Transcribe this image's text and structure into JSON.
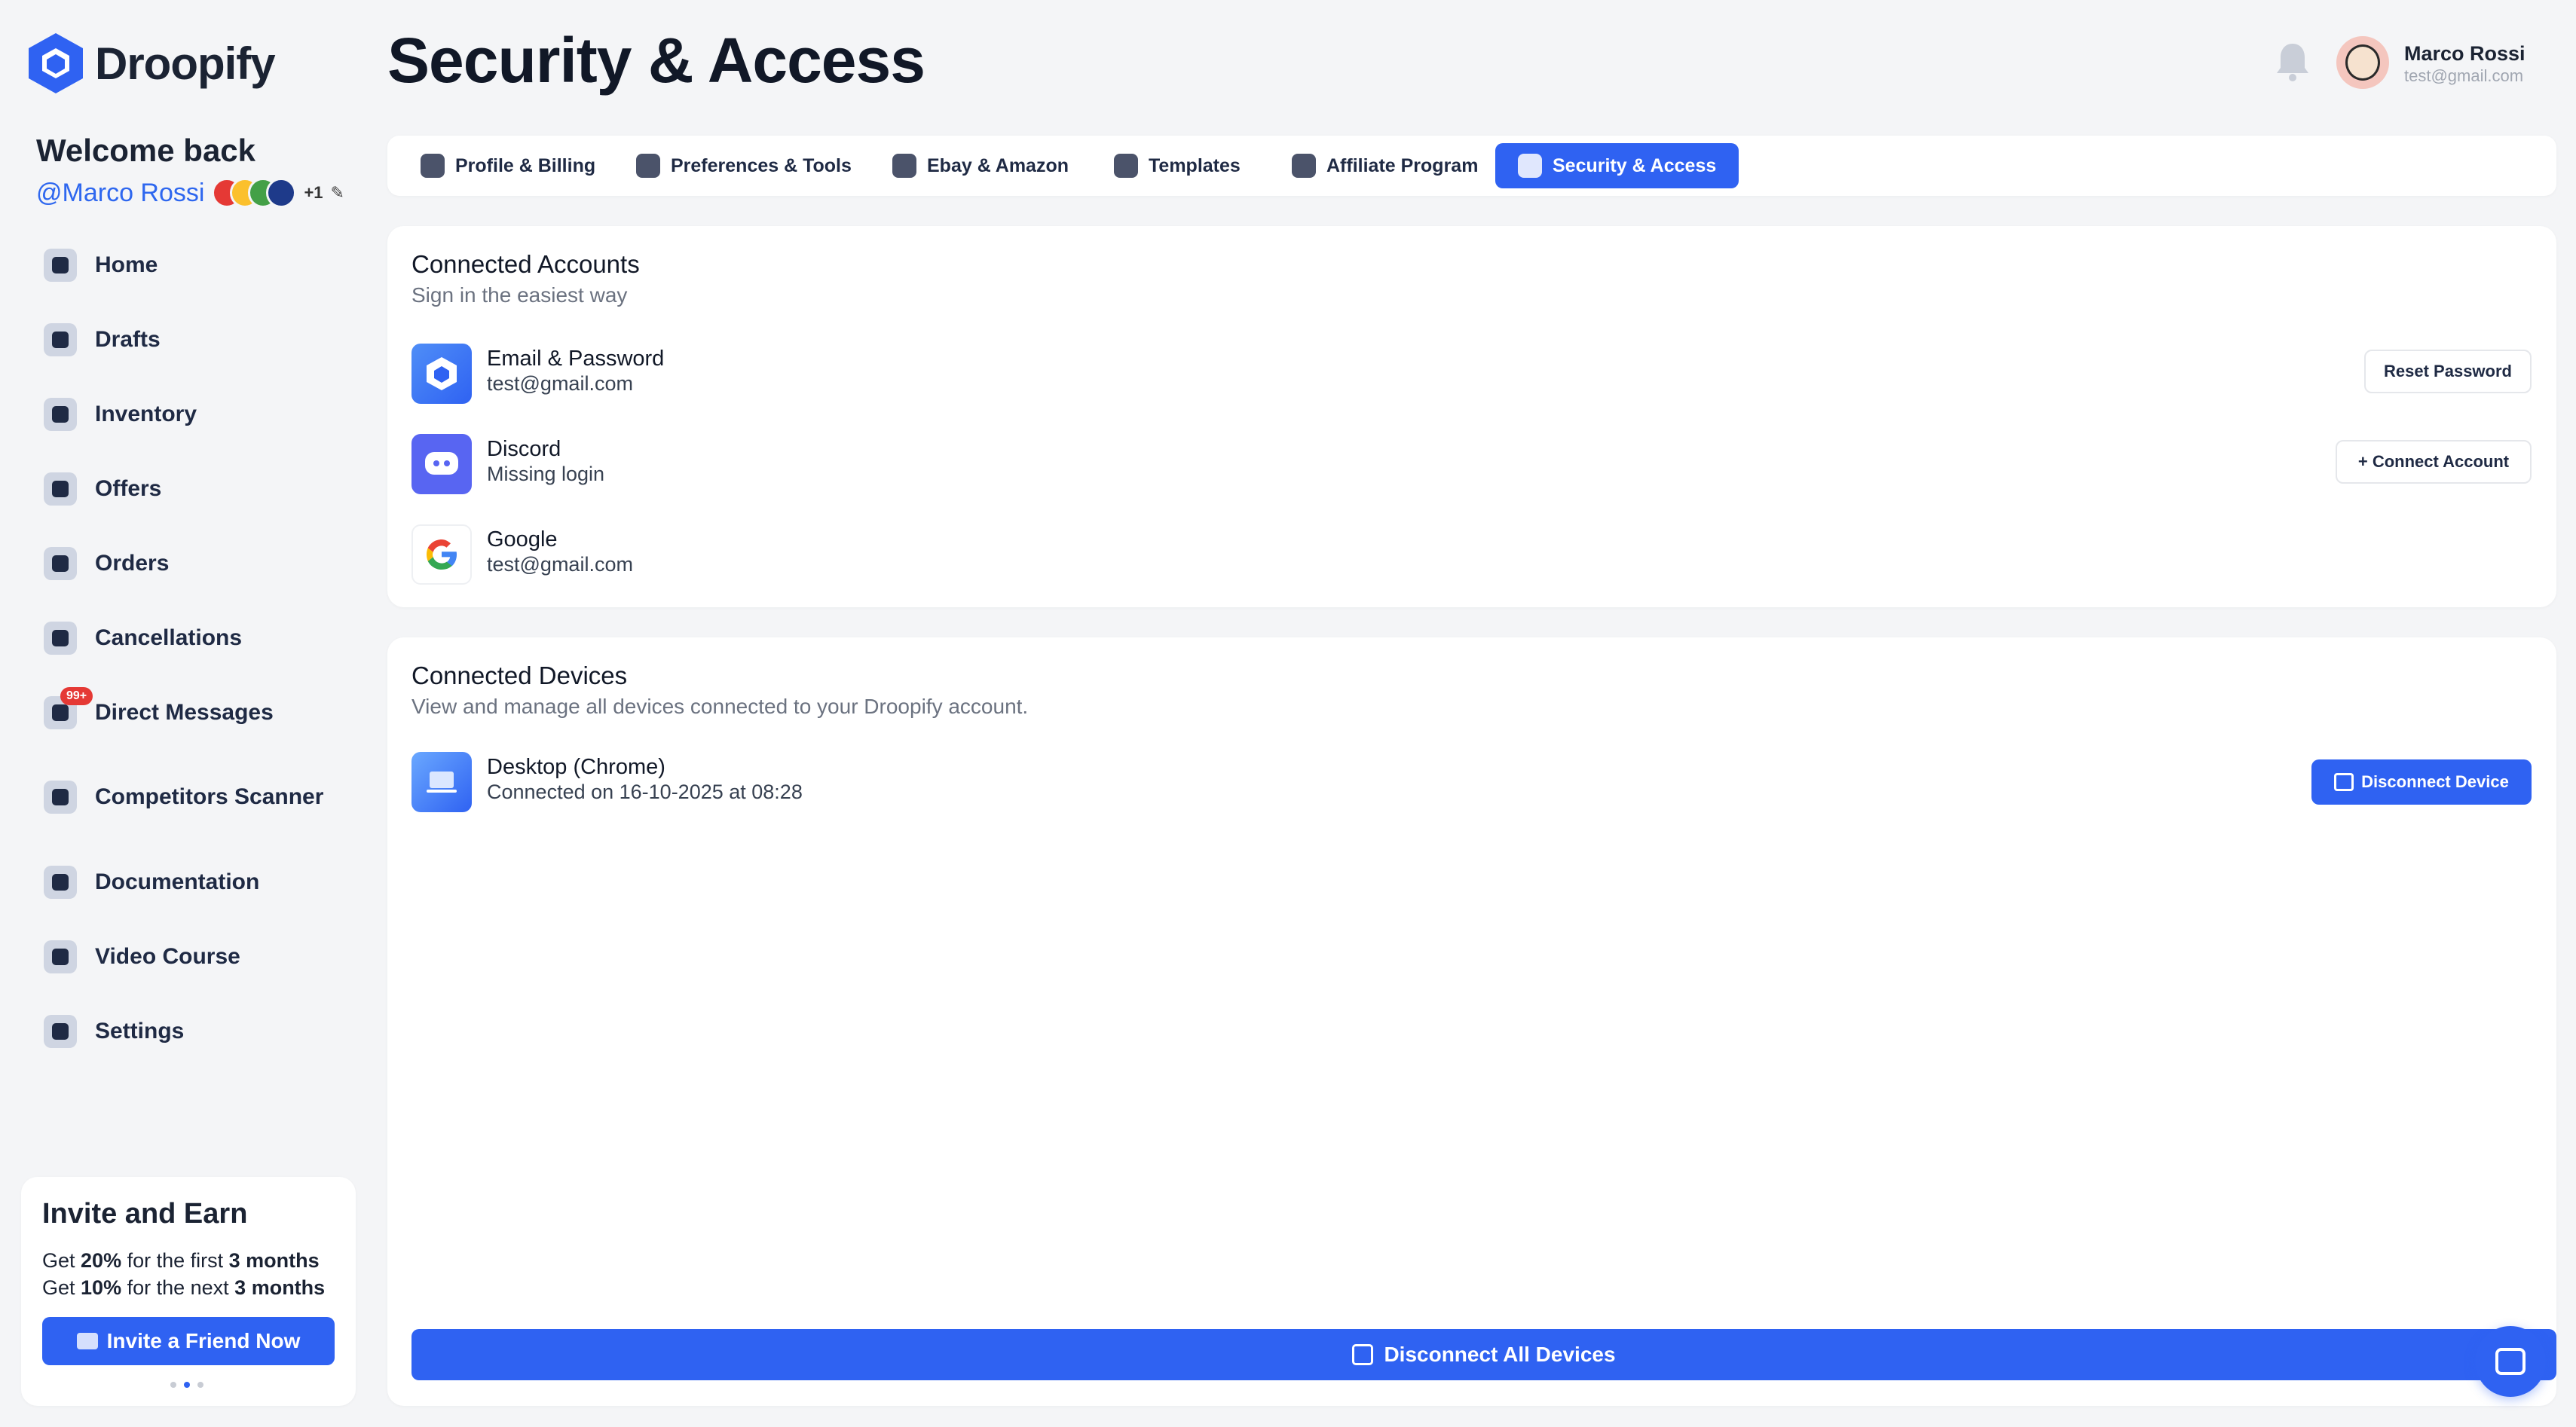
{
  "brand": {
    "name": "Droopify",
    "accent": "#2f62f2"
  },
  "sidebar": {
    "welcome": "Welcome back",
    "handle": "@Marco Rossi",
    "extra_count": "+1",
    "items": [
      {
        "label": "Home",
        "icon": "home-icon"
      },
      {
        "label": "Drafts",
        "icon": "drafts-icon"
      },
      {
        "label": "Inventory",
        "icon": "briefcase-icon"
      },
      {
        "label": "Offers",
        "icon": "discount-icon"
      },
      {
        "label": "Orders",
        "icon": "cart-icon"
      },
      {
        "label": "Cancellations",
        "icon": "arrow-left-icon"
      },
      {
        "label": "Direct Messages",
        "icon": "message-icon",
        "badge": "99+"
      },
      {
        "label": "Competitors Scanner",
        "icon": "scanner-icon"
      },
      {
        "label": "Documentation",
        "icon": "document-icon"
      },
      {
        "label": "Video Course",
        "icon": "book-icon"
      },
      {
        "label": "Settings",
        "icon": "gear-icon"
      }
    ],
    "invite": {
      "title": "Invite and Earn",
      "line1": {
        "prefix": "Get ",
        "pct": "20%",
        "mid": " for the first ",
        "dur": "3 months"
      },
      "line2": {
        "prefix": "Get ",
        "pct": "10%",
        "mid": " for the next ",
        "dur": "3 months"
      },
      "button": "Invite a Friend Now"
    }
  },
  "header": {
    "title": "Security & Access",
    "user_name": "Marco Rossi",
    "user_email": "test@gmail.com"
  },
  "tabs": [
    {
      "label": "Profile & Billing",
      "icon": "gear-icon"
    },
    {
      "label": "Preferences & Tools",
      "icon": "grid-icon"
    },
    {
      "label": "Ebay & Amazon",
      "icon": "user-plus-icon"
    },
    {
      "label": "Templates",
      "icon": "image-icon"
    },
    {
      "label": "Affiliate Program",
      "icon": "users-icon"
    },
    {
      "label": "Security & Access",
      "icon": "lock-icon",
      "active": true
    }
  ],
  "connected_accounts": {
    "title": "Connected Accounts",
    "subtitle": "Sign in the easiest way",
    "rows": [
      {
        "name": "Email & Password",
        "detail": "test@gmail.com",
        "action": "Reset Password",
        "icon": "droopify-icon"
      },
      {
        "name": "Discord",
        "detail": "Missing login",
        "action": "+ Connect Account",
        "icon": "discord-icon"
      },
      {
        "name": "Google",
        "detail": "test@gmail.com",
        "action": "",
        "icon": "google-icon"
      }
    ]
  },
  "connected_devices": {
    "title": "Connected Devices",
    "subtitle": "View and manage all devices connected to your Droopify account.",
    "rows": [
      {
        "name": "Desktop (Chrome)",
        "detail": "Connected on 16-10-2025 at 08:28",
        "action": "Disconnect Device",
        "icon": "laptop-icon"
      }
    ],
    "disconnect_all": "Disconnect All Devices"
  }
}
